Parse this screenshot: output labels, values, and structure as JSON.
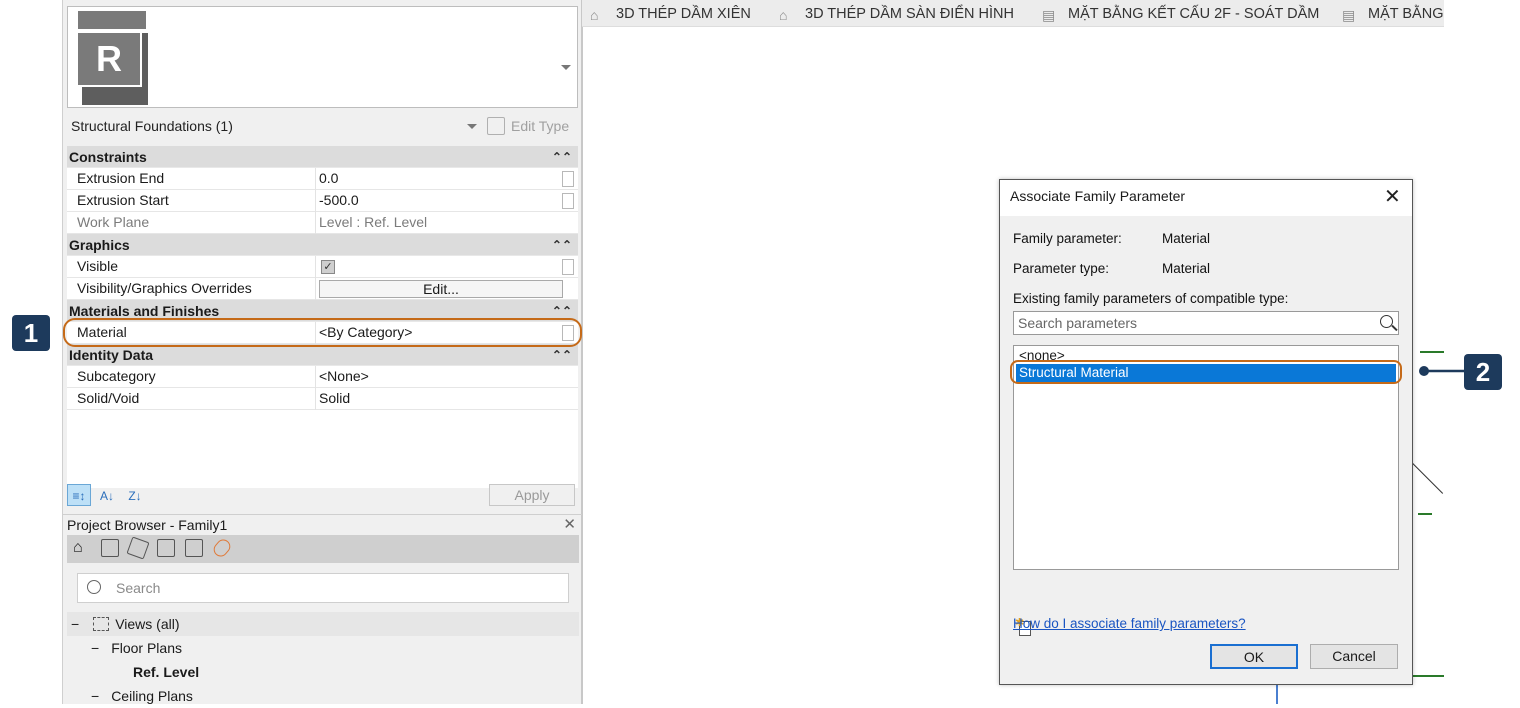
{
  "properties": {
    "type_selector": "Structural Foundations (1)",
    "edit_type": "Edit Type",
    "groups": [
      {
        "name": "Constraints",
        "rows": [
          {
            "key": "Extrusion End",
            "value": "0.0"
          },
          {
            "key": "Extrusion Start",
            "value": "-500.0"
          },
          {
            "key": "Work Plane",
            "value": "Level : Ref. Level"
          }
        ]
      },
      {
        "name": "Graphics",
        "rows": [
          {
            "key": "Visible",
            "value": "✓"
          },
          {
            "key": "Visibility/Graphics Overrides",
            "value": "Edit..."
          }
        ]
      },
      {
        "name": "Materials and Finishes",
        "rows": [
          {
            "key": "Material",
            "value": "<By Category>"
          }
        ]
      },
      {
        "name": "Identity Data",
        "rows": [
          {
            "key": "Subcategory",
            "value": "<None>"
          },
          {
            "key": "Solid/Void",
            "value": "Solid"
          }
        ]
      }
    ],
    "apply": "Apply"
  },
  "browser": {
    "title": "Project Browser - Family1",
    "search_placeholder": "Search",
    "tree": [
      {
        "label": "Views (all)",
        "prefix": "−"
      },
      {
        "label": "Floor Plans",
        "prefix": "−"
      },
      {
        "label": "Ref. Level",
        "prefix": ""
      },
      {
        "label": "Ceiling Plans",
        "prefix": "−"
      }
    ]
  },
  "tabs": [
    "3D THÉP DẦM XIÊN",
    "3D THÉP DẦM SÀN ĐIỂN HÌNH",
    "MẶT BẰNG KẾT CẤU 2F - SOÁT DẦM",
    "MẶT BẰNG"
  ],
  "dialog": {
    "title": "Associate Family Parameter",
    "family_parameter_label": "Family parameter:",
    "family_parameter_value": "Material",
    "parameter_type_label": "Parameter type:",
    "parameter_type_value": "Material",
    "existing_label": "Existing family parameters of compatible type:",
    "search_placeholder": "Search parameters",
    "list": [
      "<none>",
      "Structural Material"
    ],
    "selected_index": 1,
    "help_link": "How do I associate family parameters?",
    "ok": "OK",
    "cancel": "Cancel"
  },
  "callouts": {
    "first": "1",
    "second": "2"
  },
  "colors": {
    "highlight": "#c56a18",
    "badge": "#1d3a5c",
    "selection": "#0a78d7",
    "link": "#1a55c2"
  }
}
